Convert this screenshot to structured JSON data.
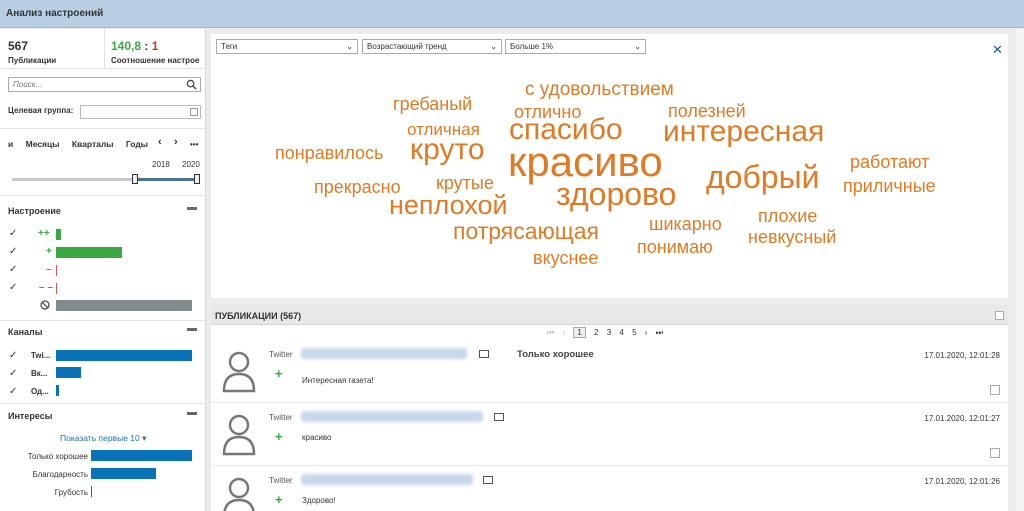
{
  "app": {
    "title": "Анализ настроений"
  },
  "stats": {
    "publications": {
      "value": "567",
      "label": "Публикации"
    },
    "ratio": {
      "pos": "140,8",
      "sep": " : ",
      "neg": "1",
      "label": "Соотношение настрое"
    }
  },
  "search": {
    "placeholder": "Поиск..."
  },
  "target_group": {
    "label": "Целевая группа:"
  },
  "periods": {
    "items": [
      "и",
      "Месяцы",
      "Кварталы",
      "Годы"
    ],
    "more": "•••",
    "year_from": "2018",
    "year_to": "2020"
  },
  "sentiment": {
    "title": "Настроение",
    "rows": [
      {
        "sign": "++",
        "value": 5,
        "color": "#3aa843"
      },
      {
        "sign": "+",
        "value": 66,
        "color": "#3aa843"
      },
      {
        "sign": "–",
        "value": 1,
        "color": "#d9534f"
      },
      {
        "sign": "– –",
        "value": 0,
        "color": "#d9534f"
      },
      {
        "sign": "blocked",
        "value": 136,
        "color": "#7f8c8d"
      }
    ]
  },
  "channels": {
    "title": "Каналы",
    "rows": [
      {
        "label": "Twi...",
        "value": 136,
        "color": "#0a72b8"
      },
      {
        "label": "Вк...",
        "value": 25,
        "color": "#0a72b8"
      },
      {
        "label": "Од...",
        "value": 3,
        "color": "#0a72b8"
      }
    ]
  },
  "interests": {
    "title": "Интересы",
    "show_first": "Показать первые 10",
    "rows": [
      {
        "label": "Только хорошее",
        "value": 100,
        "color": "#0a72b8"
      },
      {
        "label": "Благодарность",
        "value": 64,
        "color": "#0a72b8"
      },
      {
        "label": "Грубость",
        "value": 1,
        "color": "#0a72b8"
      }
    ]
  },
  "filters": {
    "type": "Теги",
    "trend": "Возрастающий тренд",
    "threshold": "Больше 1%"
  },
  "cloud": {
    "words": [
      {
        "text": "с удовольствием",
        "size": 19
      },
      {
        "text": "гребаный",
        "size": 18
      },
      {
        "text": "отлично",
        "size": 18
      },
      {
        "text": "полезней",
        "size": 18
      },
      {
        "text": "отличная",
        "size": 17
      },
      {
        "text": "спасибо",
        "size": 30
      },
      {
        "text": "интересная",
        "size": 30
      },
      {
        "text": "понравилось",
        "size": 18
      },
      {
        "text": "круто",
        "size": 30
      },
      {
        "text": "красиво",
        "size": 42
      },
      {
        "text": "работают",
        "size": 18
      },
      {
        "text": "прекрасно",
        "size": 18
      },
      {
        "text": "крутые",
        "size": 18
      },
      {
        "text": "добрый",
        "size": 32
      },
      {
        "text": "приличные",
        "size": 18
      },
      {
        "text": "здорово",
        "size": 32
      },
      {
        "text": "неплохой",
        "size": 27
      },
      {
        "text": "плохие",
        "size": 18
      },
      {
        "text": "шикарно",
        "size": 18
      },
      {
        "text": "потрясающая",
        "size": 23
      },
      {
        "text": "невкусный",
        "size": 18
      },
      {
        "text": "понимаю",
        "size": 18
      },
      {
        "text": "вкуснее",
        "size": 18
      }
    ]
  },
  "publications": {
    "title": "ПУБЛИКАЦИИ (567)",
    "pages": [
      "1",
      "2",
      "3",
      "4",
      "5"
    ],
    "current_page": "1",
    "posts": [
      {
        "source": "Twitter",
        "text": "Интересная газета!",
        "time": "17.01.2020, 12:01:28",
        "tag": "Только хорошее"
      },
      {
        "source": "Twitter",
        "text": "красиво",
        "time": "17.01.2020, 12:01:27",
        "tag": ""
      },
      {
        "source": "Twitter",
        "text": "Здорово!",
        "time": "17.01.2020, 12:01:26",
        "tag": ""
      }
    ]
  }
}
